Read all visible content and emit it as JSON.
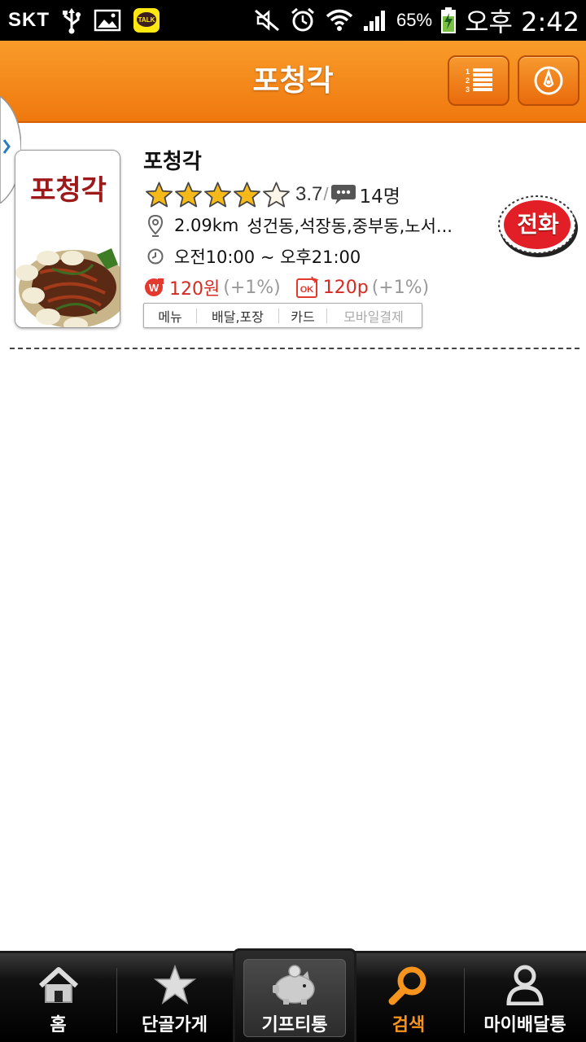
{
  "status_bar": {
    "carrier": "SKT",
    "battery": "65%",
    "time": "오후 2:42"
  },
  "header": {
    "title": "포청각"
  },
  "store": {
    "name": "포청각",
    "rating": "3.7",
    "rating_stars": 4,
    "review_count": "14명",
    "distance": "2.09km",
    "area": "성건동,석장동,중부동,노서...",
    "hours": "오전10:00 ~ 오후21:00",
    "point_won": "120원",
    "point_won_pct": "(+1%)",
    "point_ok": "120p",
    "point_ok_pct": "(+1%)",
    "tags": [
      "메뉴",
      "배달,포장",
      "카드",
      "모바일결제"
    ],
    "thumb_text": "포청각",
    "call_label": "전화"
  },
  "nav": {
    "items": [
      {
        "label": "홈",
        "icon": "home-icon"
      },
      {
        "label": "단골가게",
        "icon": "star-icon"
      },
      {
        "label": "기프티통",
        "icon": "piggy-bank-icon"
      },
      {
        "label": "검색",
        "icon": "search-icon",
        "active": true
      },
      {
        "label": "마이배달통",
        "icon": "person-icon"
      }
    ]
  },
  "colors": {
    "header_orange": "#f0780e",
    "accent": "#f7941d",
    "point_red": "#d42b22",
    "call_red": "#e21f26"
  }
}
